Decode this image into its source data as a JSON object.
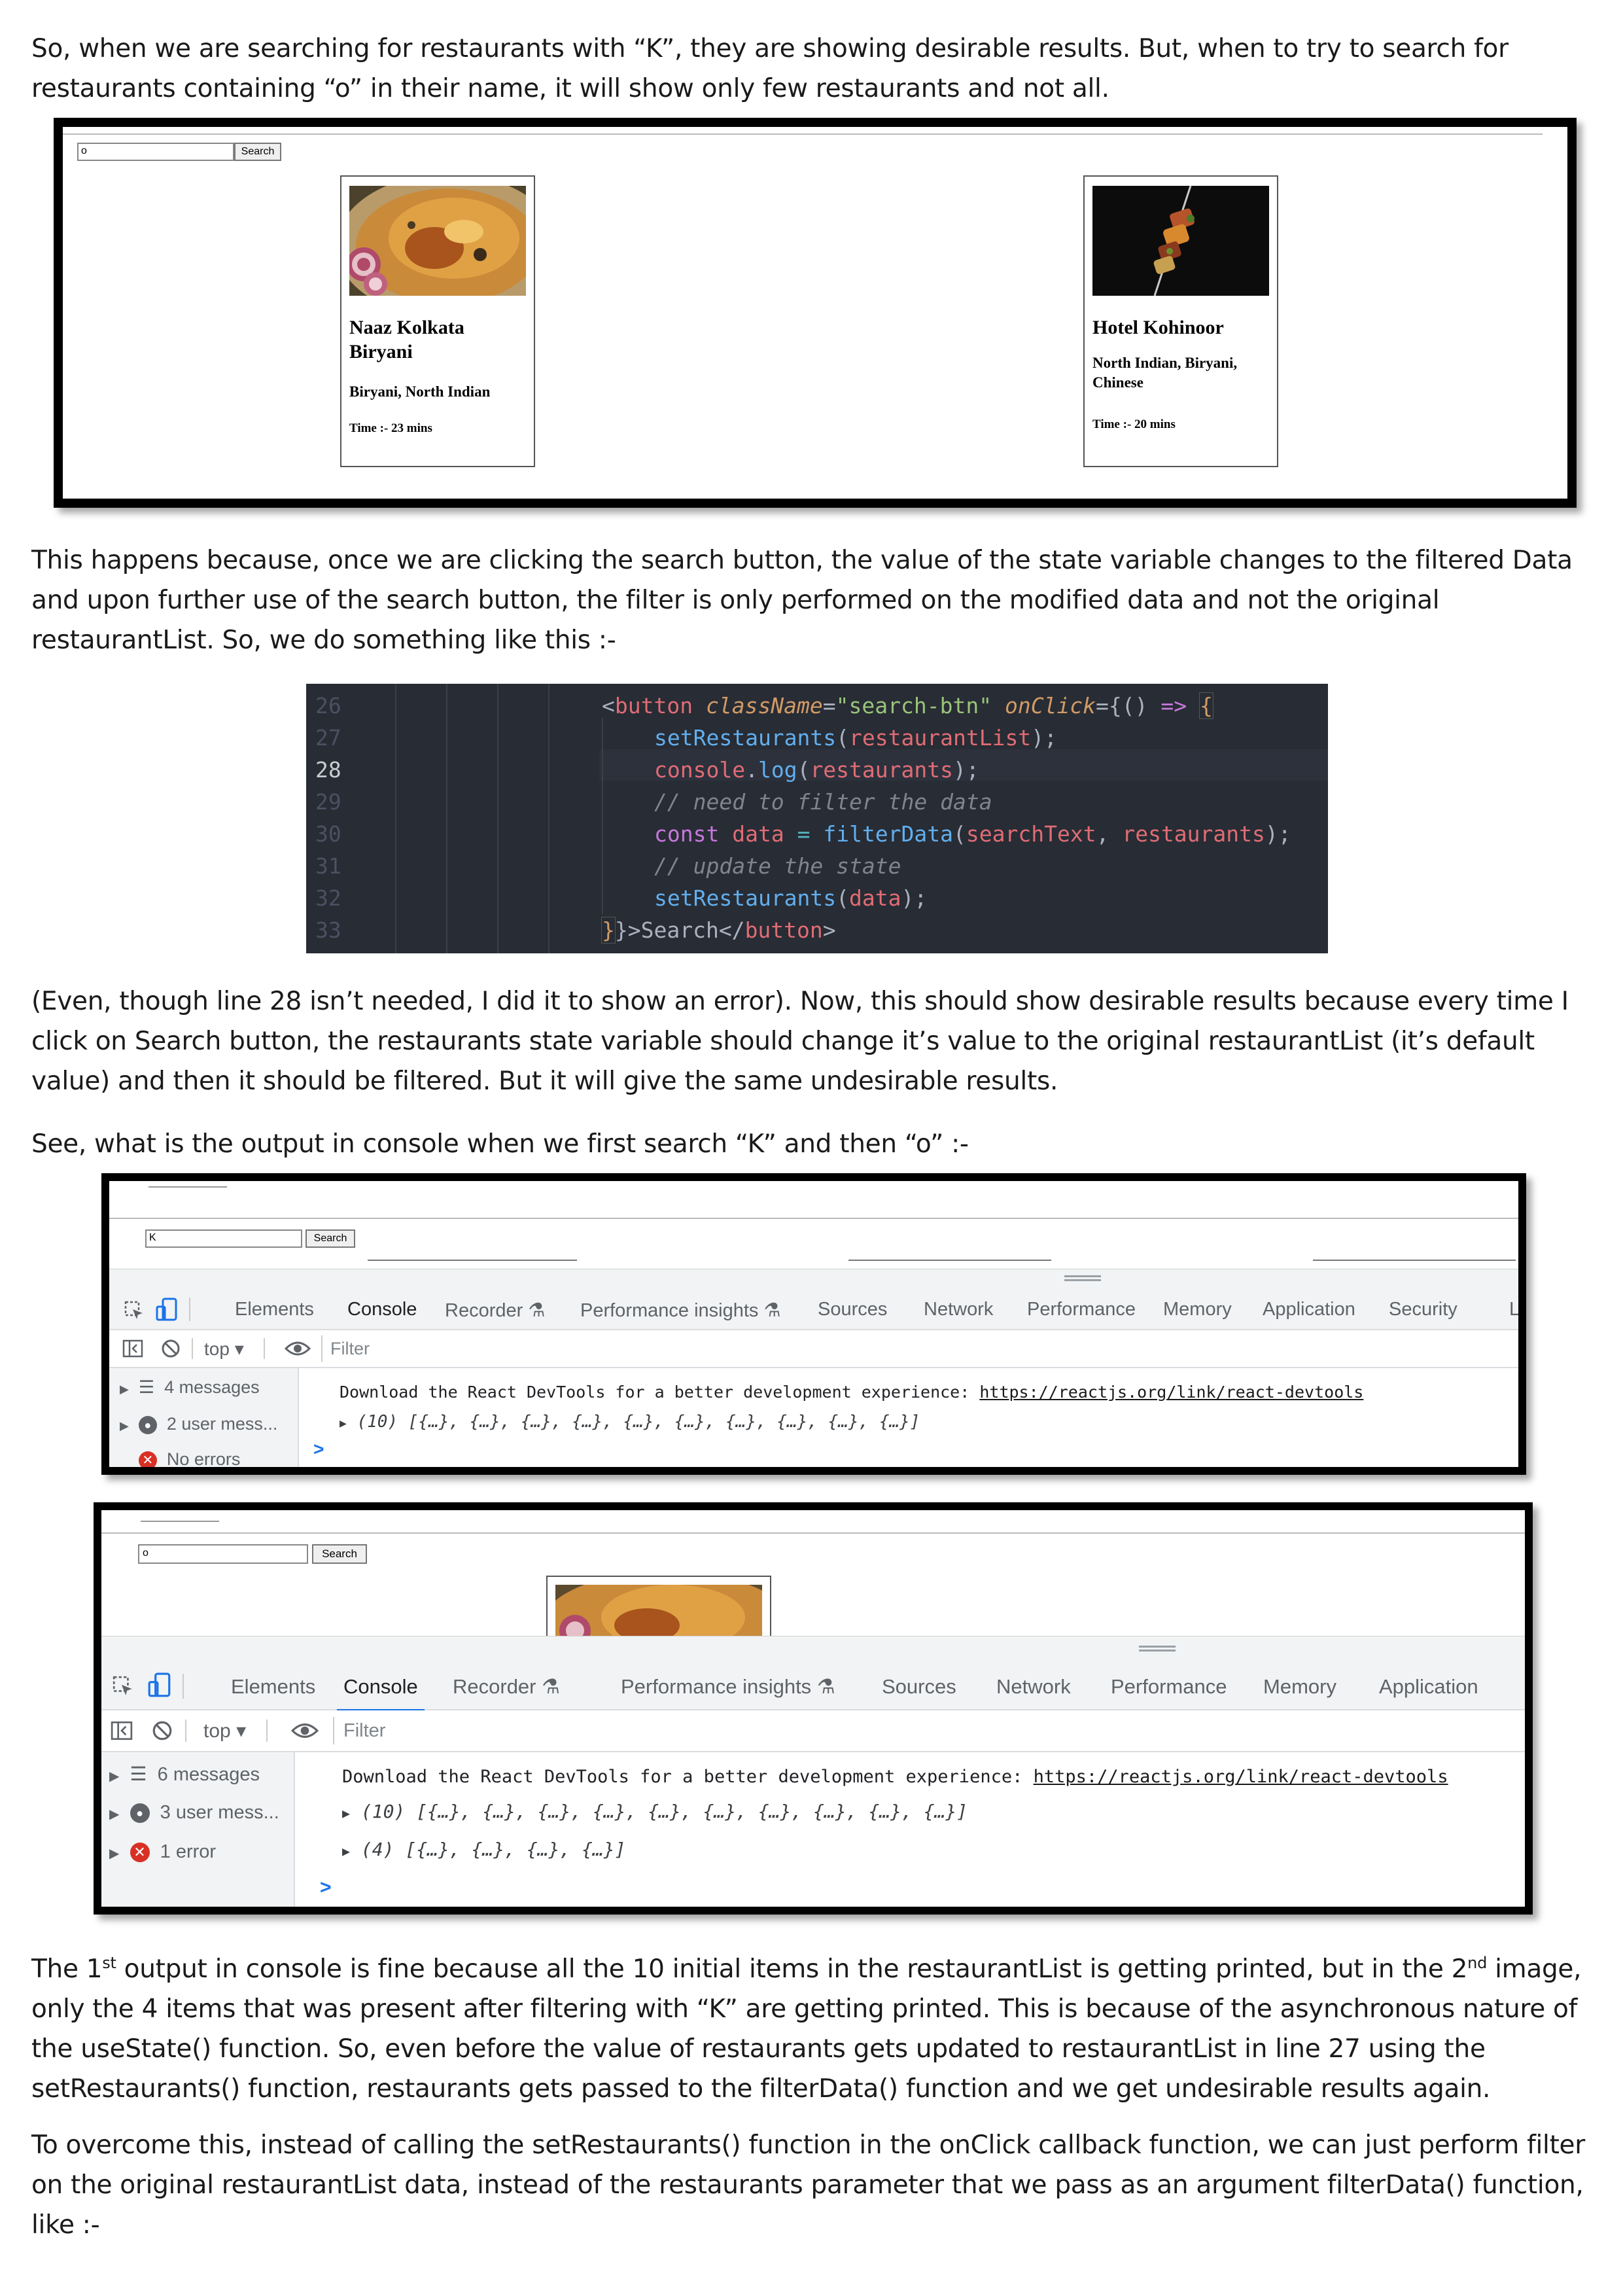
{
  "paragraphs": {
    "p1": "So, when we are searching for restaurants with “K”, they are showing desirable results. But, when to try to search for restaurants containing “o” in their name, it will show only few restaurants and not all.",
    "p2": "This happens because, once we are clicking the search button, the value of the state variable changes to the filtered Data and upon further use of the search button, the filter is only performed on the modified data and not the original restaurantList. So, we do something like this :-",
    "p3": "(Even, though line 28 isn’t needed, I did it to show an error). Now, this should show desirable results because every time I click on Search button, the restaurants state variable should change it’s value to the original restaurantList (it’s default value) and then it should be filtered. But it will give the same undesirable results.",
    "p4": "See, what is the output in console when we first search “K” and then “o” :-",
    "p5_a": "The 1",
    "p5_sup1": "st",
    "p5_b": " output in console is fine because all the 10 initial items in the restaurantList is getting printed, but in the 2",
    "p5_sup2": "nd",
    "p5_c": " image, only the 4 items that was present after filtering with “K” are getting printed. This is because of the asynchronous nature of the useState() function. So, even before the value of restaurants gets updated to restaurantList in line 27 using the setRestaurants() function, restaurants gets passed to the filterData() function and we get undesirable results again.",
    "p6": "To overcome this, instead of calling the setRestaurants() function in the onClick callback function, we can just perform filter on the original restaurantList data, instead of the restaurants parameter that we pass as an argument filterData() function, like :-"
  },
  "figure1": {
    "search_value": "o",
    "search_button": "Search",
    "cards": [
      {
        "name": "Naaz Kolkata Biryani",
        "cuisine": "Biryani, North Indian",
        "time": "Time :- 23 mins",
        "image": "biryani-photo"
      },
      {
        "name": "Hotel Kohinoor",
        "cuisine": "North Indian, Biryani, Chinese",
        "time": "Time :- 20 mins",
        "image": "kebab-photo"
      }
    ]
  },
  "code": {
    "line_numbers": [
      "26",
      "27",
      "28",
      "29",
      "30",
      "31",
      "32",
      "33"
    ],
    "current_line": "28"
  },
  "devtools1": {
    "search_value": "K",
    "search_button": "Search",
    "tabs": [
      "Elements",
      "Console",
      "Recorder",
      "Performance insights",
      "Sources",
      "Network",
      "Performance",
      "Memory",
      "Application",
      "Security",
      "L"
    ],
    "active_tab": "Console",
    "context": "top",
    "filter_placeholder": "Filter",
    "sidebar": [
      "4 messages",
      "2 user mess...",
      "No errors"
    ],
    "message": "Download the React DevTools for a better development experience: ",
    "link": "https://reactjs.org/link/react-devtools",
    "logs": [
      "(10) [{…}, {…}, {…}, {…}, {…}, {…}, {…}, {…}, {…}, {…}]"
    ],
    "prompt": ">"
  },
  "devtools2": {
    "search_value": "o",
    "search_button": "Search",
    "tabs": [
      "Elements",
      "Console",
      "Recorder",
      "Performance insights",
      "Sources",
      "Network",
      "Performance",
      "Memory",
      "Application"
    ],
    "active_tab": "Console",
    "context": "top",
    "filter_placeholder": "Filter",
    "sidebar": [
      "6 messages",
      "3 user mess...",
      "1 error"
    ],
    "message": "Download the React DevTools for a better development experience: ",
    "link": "https://reactjs.org/link/react-devtools",
    "logs": [
      "(10) [{…}, {…}, {…}, {…}, {…}, {…}, {…}, {…}, {…}, {…}]",
      "(4) [{…}, {…}, {…}, {…}]"
    ],
    "prompt": ">"
  },
  "colors": {
    "code_bg": "#282c34",
    "devtools_active_tab": "#1a73e8",
    "error_icon": "#d93025"
  }
}
